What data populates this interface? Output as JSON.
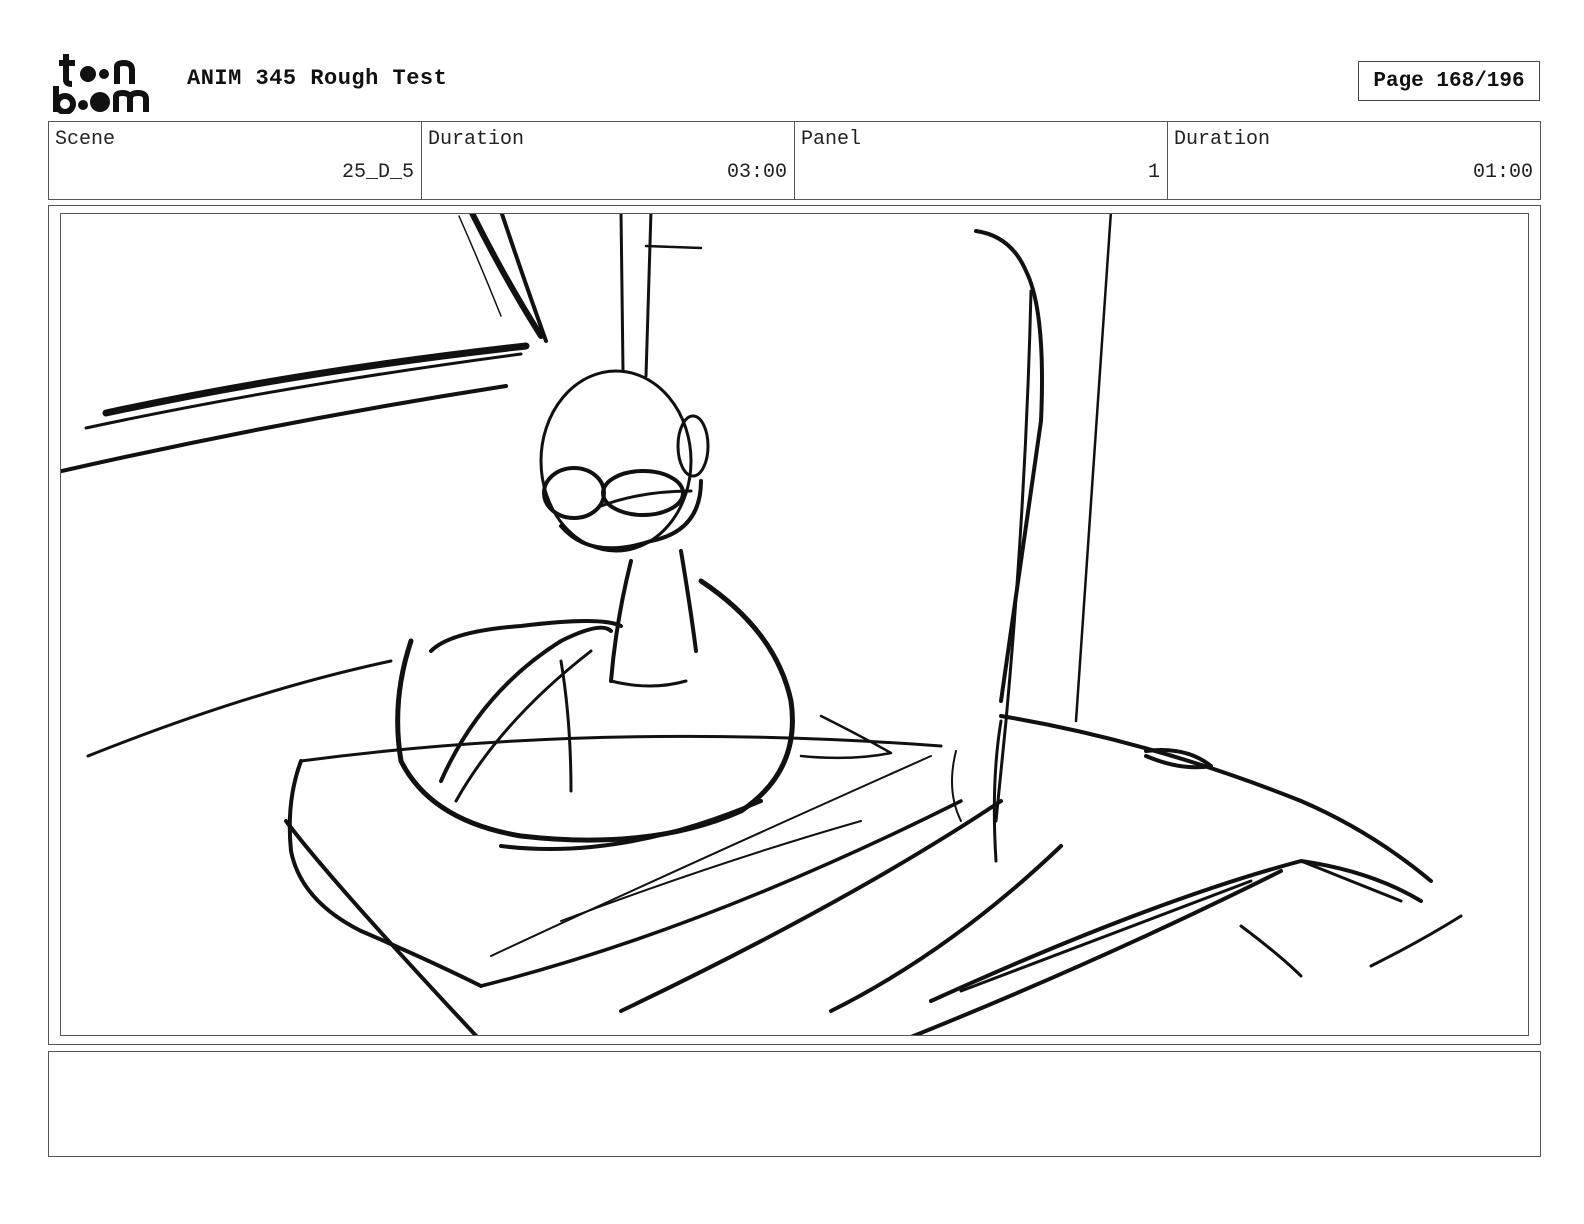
{
  "header": {
    "logo_text_top": "toon",
    "logo_text_bottom": "boom",
    "title": "ANIM 345 Rough Test",
    "page_label": "Page 168/196"
  },
  "info": {
    "scene_label": "Scene",
    "scene_value": "25_D_5",
    "scene_duration_label": "Duration",
    "scene_duration_value": "03:00",
    "panel_label": "Panel",
    "panel_value": "1",
    "panel_duration_label": "Duration",
    "panel_duration_value": "01:00"
  },
  "panel": {
    "image": "rough-sketch-duck-on-table"
  },
  "notes": {
    "text": ""
  }
}
